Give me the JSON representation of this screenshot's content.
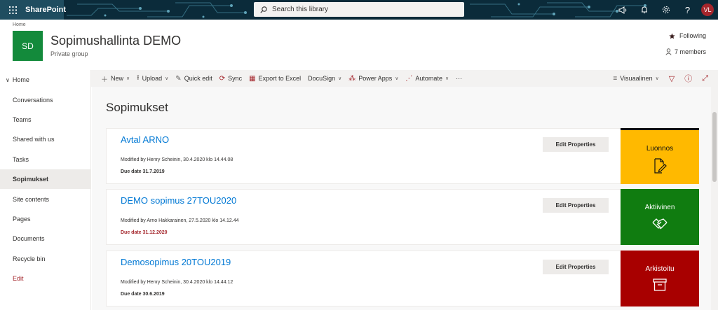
{
  "suite": {
    "brand": "SharePoint",
    "search_placeholder": "Search this library",
    "avatar_initials": "VL"
  },
  "site": {
    "home_link": "Home",
    "logo_initials": "SD",
    "title": "Sopimushallinta DEMO",
    "subtitle": "Private group",
    "following_label": "Following",
    "members_label": "7 members",
    "logo_color": "#138a3b"
  },
  "nav": {
    "items": [
      {
        "label": "Home"
      },
      {
        "label": "Conversations"
      },
      {
        "label": "Teams"
      },
      {
        "label": "Shared with us"
      },
      {
        "label": "Tasks"
      },
      {
        "label": "Sopimukset",
        "active": true
      },
      {
        "label": "Site contents"
      },
      {
        "label": "Pages"
      },
      {
        "label": "Documents"
      },
      {
        "label": "Recycle bin"
      },
      {
        "label": "Edit"
      }
    ]
  },
  "commands": {
    "new": "New",
    "upload": "Upload",
    "quick_edit": "Quick edit",
    "sync": "Sync",
    "export": "Export to Excel",
    "docusign": "DocuSign",
    "power_apps": "Power Apps",
    "automate": "Automate",
    "more": "···",
    "view": "Visuaalinen"
  },
  "library": {
    "title": "Sopimukset",
    "items": [
      {
        "title": "Avtal ARNO",
        "modified": "Modified by Henry Scheinin, 30.4.2020 klo 14.44.08",
        "due": "Due date 31.7.2019",
        "due_overdue": false,
        "edit_label": "Edit Properties",
        "status": "Luonnos",
        "status_color": "#ffb900",
        "status_icon": "edit-document-icon"
      },
      {
        "title": "DEMO sopimus 27TOU2020",
        "modified": "Modified by Arno Hakkarainen, 27.5.2020 klo 14.12.44",
        "due": "Due date 31.12.2020",
        "due_overdue": true,
        "edit_label": "Edit Properties",
        "status": "Aktiivinen",
        "status_color": "#107c10",
        "status_icon": "handshake-icon"
      },
      {
        "title": "Demosopimus 20TOU2019",
        "modified": "Modified by Henry Scheinin, 30.4.2020 klo 14.44.12",
        "due": "Due date 30.6.2019",
        "due_overdue": false,
        "edit_label": "Edit Properties",
        "status": "Arkistoitu",
        "status_color": "#a80000",
        "status_icon": "archive-icon"
      }
    ]
  }
}
